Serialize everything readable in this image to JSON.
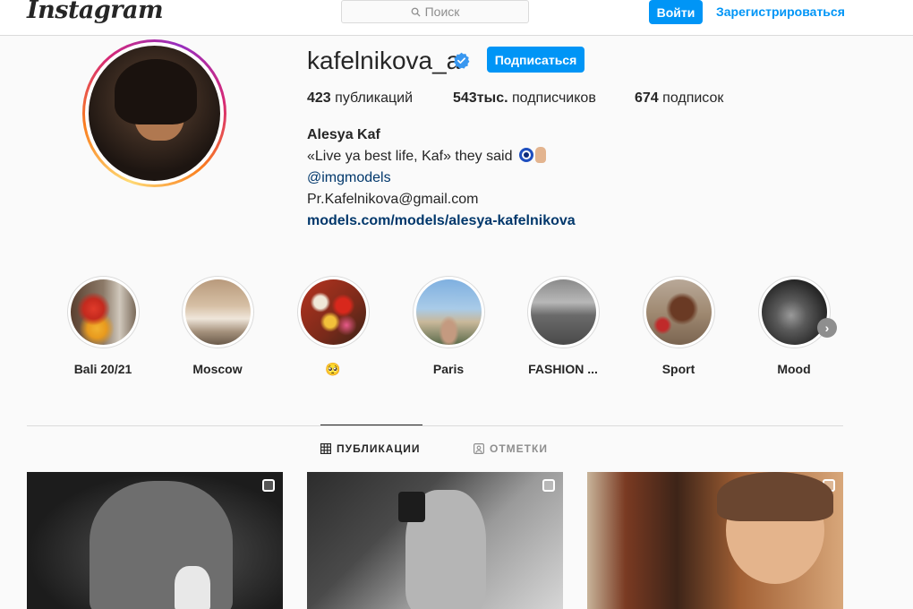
{
  "header": {
    "logo": "Instagram",
    "search_placeholder": "Поиск",
    "login_label": "Войти",
    "signup_label": "Зарегистрироваться"
  },
  "profile": {
    "username": "kafelnikova_a",
    "follow_label": "Подписаться",
    "stats": {
      "posts_count": "423",
      "posts_label": " публикаций",
      "followers_count": "543тыс.",
      "followers_label": " подписчиков",
      "following_count": "674",
      "following_label": " подписок"
    },
    "bio": {
      "name": "Alesya Kaf",
      "line": "«Live ya best life, Kaf» they said",
      "mention": "@imgmodels",
      "email": "Pr.Kafelnikova@gmail.com",
      "url": "models.com/models/alesya-kafelnikova"
    }
  },
  "highlights": [
    {
      "label": "Bali 20/21"
    },
    {
      "label": "Moscow"
    },
    {
      "label": "🥺"
    },
    {
      "label": "Paris"
    },
    {
      "label": "FASHION ..."
    },
    {
      "label": "Sport"
    },
    {
      "label": "Mood"
    }
  ],
  "tabs": {
    "posts_label": "ПУБЛИКАЦИИ",
    "tagged_label": "ОТМЕТКИ"
  },
  "colors": {
    "accent": "#0095f6",
    "link": "#00376b",
    "text": "#262626",
    "muted": "#8e8e8e"
  }
}
